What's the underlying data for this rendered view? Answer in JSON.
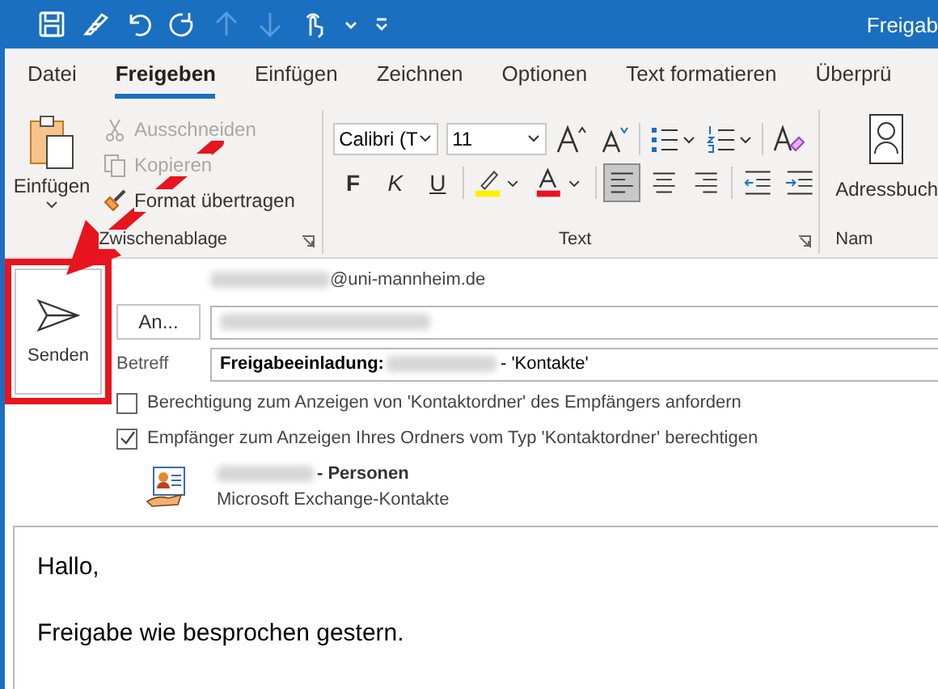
{
  "window": {
    "title": "Freigab"
  },
  "quick_access": [
    {
      "kind": "save",
      "disabled": false
    },
    {
      "kind": "pen",
      "disabled": false
    },
    {
      "kind": "undo",
      "disabled": false
    },
    {
      "kind": "redo",
      "disabled": false
    },
    {
      "kind": "up",
      "disabled": true
    },
    {
      "kind": "down",
      "disabled": true
    },
    {
      "kind": "touch",
      "disabled": false
    },
    {
      "kind": "caret",
      "disabled": false
    },
    {
      "kind": "customize",
      "disabled": false
    }
  ],
  "tabs": [
    {
      "label": "Datei",
      "selected": false
    },
    {
      "label": "Freigeben",
      "selected": true
    },
    {
      "label": "Einfügen",
      "selected": false
    },
    {
      "label": "Zeichnen",
      "selected": false
    },
    {
      "label": "Optionen",
      "selected": false
    },
    {
      "label": "Text formatieren",
      "selected": false
    },
    {
      "label": "Überprü",
      "selected": false
    }
  ],
  "ribbon": {
    "clipboard": {
      "label": "Zwischenablage",
      "paste": "Einfügen",
      "items": [
        {
          "kind": "cut",
          "label": "Ausschneiden",
          "disabled": true
        },
        {
          "kind": "copy",
          "label": "Kopieren",
          "disabled": true
        },
        {
          "kind": "format",
          "label": "Format übertragen",
          "disabled": false
        }
      ]
    },
    "text": {
      "label": "Text",
      "font": "Calibri (T",
      "size": "11",
      "styles": [
        {
          "kind": "bold",
          "label": "F"
        },
        {
          "kind": "italic",
          "label": "K"
        },
        {
          "kind": "underline",
          "label": "U"
        }
      ],
      "align": [
        {
          "kind": "left",
          "selected": true
        },
        {
          "kind": "center",
          "selected": false
        },
        {
          "kind": "right",
          "selected": false
        }
      ]
    },
    "names": {
      "label": "Nam",
      "address_book": "Adressbuch"
    }
  },
  "message": {
    "send": "Senden",
    "from_suffix": "@uni-mannheim.de",
    "to_button": "An...",
    "subject_label": "Betreff",
    "subject_prefix": "Freigabeeinladung:",
    "subject_suffix": "- 'Kontakte'",
    "options": [
      {
        "label": "Berechtigung zum Anzeigen von 'Kontaktordner' des Empfängers anfordern",
        "checked": false
      },
      {
        "label": "Empfänger zum Anzeigen Ihres Ordners vom Typ 'Kontaktordner' berechtigen",
        "checked": true
      }
    ],
    "attachment": {
      "title_suffix": "- Personen",
      "subtitle": "Microsoft Exchange-Kontakte"
    }
  },
  "body": {
    "lines": [
      "Hallo,",
      "Freigabe wie besprochen gestern."
    ]
  }
}
